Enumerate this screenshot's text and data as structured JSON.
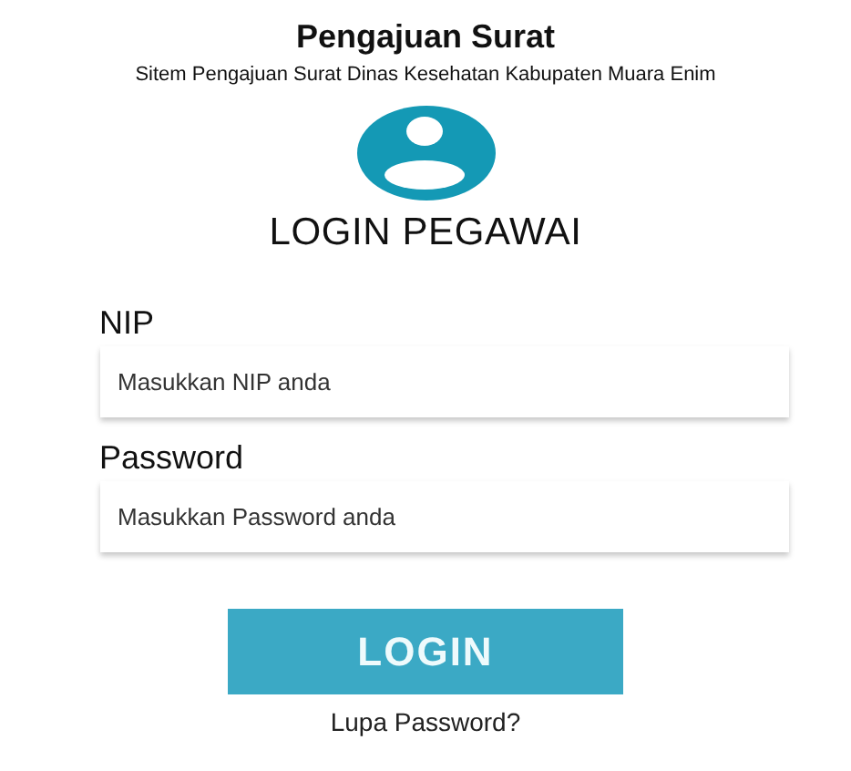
{
  "header": {
    "title": "Pengajuan Surat",
    "subtitle": "Sitem Pengajuan Surat Dinas Kesehatan Kabupaten Muara Enim"
  },
  "login": {
    "heading": "LOGIN PEGAWAI",
    "fields": [
      {
        "label": "NIP",
        "placeholder": "Masukkan NIP anda"
      },
      {
        "label": "Password",
        "placeholder": "Masukkan Password anda"
      }
    ],
    "button": "LOGIN",
    "forgot_link": "Lupa Password?"
  }
}
